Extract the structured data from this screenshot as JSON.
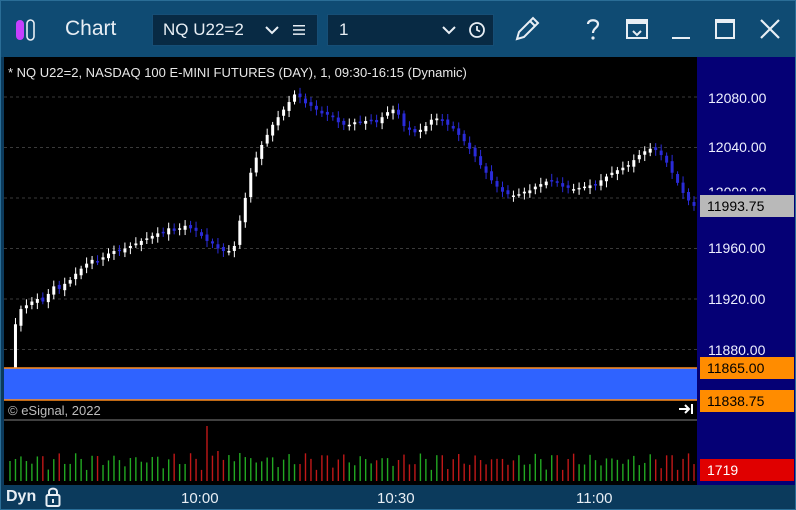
{
  "window": {
    "title": "Chart",
    "symbol": "NQ U22=2",
    "interval": "1"
  },
  "chart_info": "* NQ U22=2, NASDAQ 100 E-MINI FUTURES (DAY), 1, 09:30-16:15 (Dynamic)",
  "copyright": "© eSignal, 2022",
  "price_axis": {
    "labels": [
      "12080.00",
      "12040.00",
      "11960.00",
      "11920.00",
      "11880.00"
    ],
    "partial_label": "12000.00"
  },
  "tags": {
    "last_price": "11993.75",
    "zone_top": "11865.00",
    "zone_bottom": "11838.75",
    "volume": "1719"
  },
  "time_axis": {
    "labels": [
      "10:00",
      "10:30",
      "11:00"
    ]
  },
  "footer": {
    "mode": "Dyn"
  },
  "colors": {
    "background": "#000000",
    "axis": "#050075",
    "titlebar": "#0f4b73",
    "up_candle": "#ffffff",
    "down_candle": "#2a2bd8",
    "zone_fill": "#2f63ff",
    "zone_border": "#ff8c1a",
    "tag_orange": "#ff8c00",
    "tag_red": "#e00000",
    "volume_green": "#22a822",
    "volume_red": "#c01818"
  },
  "chart_data": {
    "type": "candlestick",
    "title": "* NQ U22=2, NASDAQ 100 E-MINI FUTURES (DAY), 1, 09:30-16:15 (Dynamic)",
    "x_ticks": [
      "10:00",
      "10:30",
      "11:00"
    ],
    "y_ticks": [
      11880,
      11920,
      11960,
      12000,
      12040,
      12080
    ],
    "ylim": [
      11838.75,
      12100
    ],
    "last_price": 11993.75,
    "zone": [
      11838.75,
      11865.0
    ],
    "volume_last": 1719,
    "close_path": [
      11855,
      11900,
      11912,
      11915,
      11918,
      11920,
      11918,
      11924,
      11930,
      11928,
      11932,
      11935,
      11940,
      11944,
      11948,
      11951,
      11950,
      11953,
      11956,
      11958,
      11958,
      11960,
      11962,
      11964,
      11966,
      11968,
      11970,
      11972,
      11972,
      11976,
      11974,
      11976,
      11978,
      11976,
      11974,
      11970,
      11966,
      11964,
      11960,
      11958,
      11958,
      11962,
      11982,
      12000,
      12020,
      12032,
      12042,
      12050,
      12058,
      12064,
      12070,
      12076,
      12082,
      12080,
      12075,
      12073,
      12070,
      12067,
      12066,
      12064,
      12060,
      12058,
      12058,
      12060,
      12060,
      12061,
      12062,
      12060,
      12064,
      12068,
      12070,
      12066,
      12057,
      12054,
      12052,
      12054,
      12057,
      12062,
      12063,
      12061,
      12058,
      12055,
      12050,
      12045,
      12039,
      12033,
      12026,
      12020,
      12014,
      12009,
      12005,
      12003,
      12002,
      12003,
      12005,
      12006,
      12009,
      12011,
      12013,
      12014,
      12012,
      12009,
      12008,
      12007,
      12008,
      12009,
      12010,
      12010,
      12014,
      12017,
      12020,
      12022,
      12024,
      12026,
      12030,
      12034,
      12037,
      12039,
      12038,
      12034,
      12028,
      12020,
      12012,
      12004,
      11998,
      11993.75
    ]
  }
}
